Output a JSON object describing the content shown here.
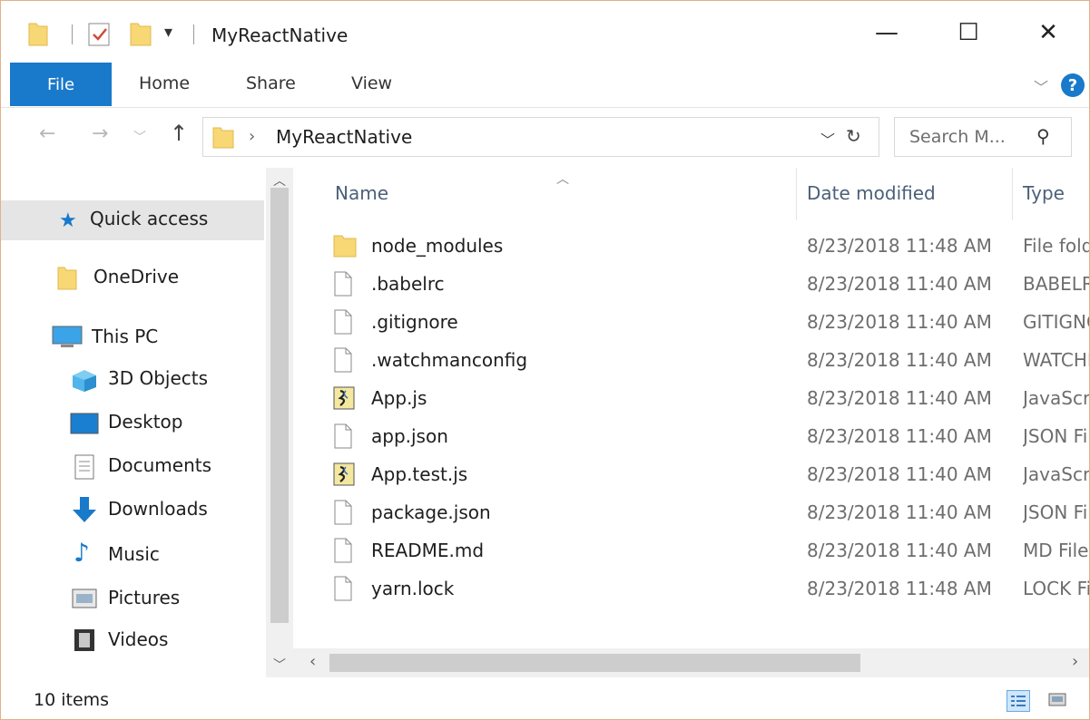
{
  "window": {
    "title": "MyReactNative",
    "controls": {
      "minimize": "—",
      "maximize": "☐",
      "close": "✕"
    }
  },
  "ribbon": {
    "tabs": [
      "File",
      "Home",
      "Share",
      "View"
    ],
    "help": "?"
  },
  "address": {
    "crumb": "MyReactNative",
    "search_placeholder": "Search M..."
  },
  "nav": {
    "quick_access": "Quick access",
    "onedrive": "OneDrive",
    "this_pc": "This PC",
    "objects3d": "3D Objects",
    "desktop": "Desktop",
    "documents": "Documents",
    "downloads": "Downloads",
    "music": "Music",
    "pictures": "Pictures",
    "videos": "Videos"
  },
  "columns": {
    "name": "Name",
    "date": "Date modified",
    "type": "Type"
  },
  "files": [
    {
      "name": "node_modules",
      "date": "8/23/2018 11:48 AM",
      "type": "File folder",
      "icon": "folder-icon"
    },
    {
      "name": ".babelrc",
      "date": "8/23/2018 11:40 AM",
      "type": "BABELRC",
      "icon": "file-icon"
    },
    {
      "name": ".gitignore",
      "date": "8/23/2018 11:40 AM",
      "type": "GITIGNORE",
      "icon": "file-icon"
    },
    {
      "name": ".watchmanconfig",
      "date": "8/23/2018 11:40 AM",
      "type": "WATCHMANCONFIG",
      "icon": "file-icon"
    },
    {
      "name": "App.js",
      "date": "8/23/2018 11:40 AM",
      "type": "JavaScript",
      "icon": "script-icon"
    },
    {
      "name": "app.json",
      "date": "8/23/2018 11:40 AM",
      "type": "JSON File",
      "icon": "file-icon"
    },
    {
      "name": "App.test.js",
      "date": "8/23/2018 11:40 AM",
      "type": "JavaScript",
      "icon": "script-icon"
    },
    {
      "name": "package.json",
      "date": "8/23/2018 11:40 AM",
      "type": "JSON File",
      "icon": "file-icon"
    },
    {
      "name": "README.md",
      "date": "8/23/2018 11:40 AM",
      "type": "MD File",
      "icon": "file-icon"
    },
    {
      "name": "yarn.lock",
      "date": "8/23/2018 11:48 AM",
      "type": "LOCK File",
      "icon": "file-icon"
    }
  ],
  "status": {
    "count": "10 items"
  },
  "colors": {
    "accent": "#1979ca",
    "folder": "#f8d775",
    "header_text": "#4c607a"
  }
}
